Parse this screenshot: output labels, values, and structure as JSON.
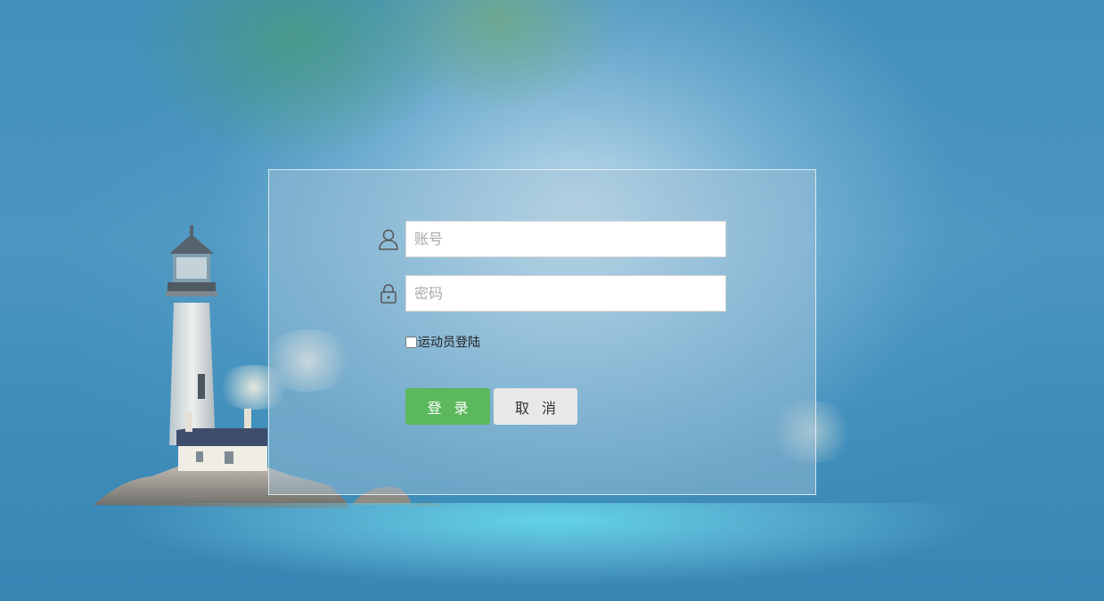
{
  "login_form": {
    "account_placeholder": "账号",
    "account_value": "",
    "password_placeholder": "密码",
    "password_value": "",
    "athlete_login_label": "运动员登陆",
    "athlete_login_checked": false,
    "login_label": "登录",
    "cancel_label": "取消",
    "account_icon": "user-icon",
    "password_icon": "lock-icon"
  },
  "colors": {
    "login_button": "#5cb85c",
    "cancel_button": "#e8e8e8",
    "panel_border": "#ffffff"
  }
}
